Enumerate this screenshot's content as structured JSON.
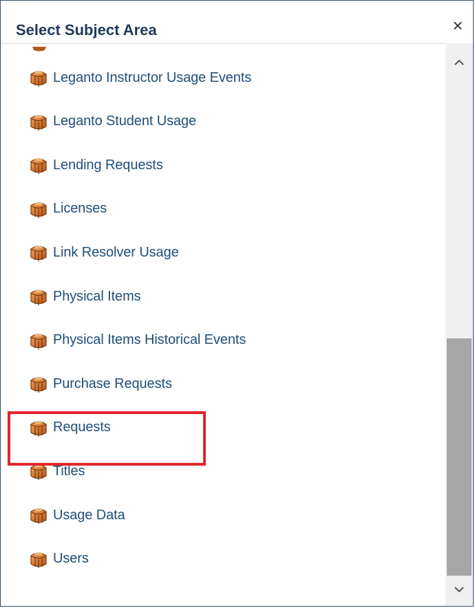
{
  "dialog": {
    "title": "Select Subject Area",
    "close_glyph": "×"
  },
  "items": [
    {
      "label": "Leganto Instructor Usage Events",
      "icon": "subject-area-cube-icon"
    },
    {
      "label": "Leganto Student Usage",
      "icon": "subject-area-cube-icon"
    },
    {
      "label": "Lending Requests",
      "icon": "subject-area-cube-icon"
    },
    {
      "label": "Licenses",
      "icon": "subject-area-cube-icon"
    },
    {
      "label": "Link Resolver Usage",
      "icon": "subject-area-cube-icon"
    },
    {
      "label": "Physical Items",
      "icon": "subject-area-cube-icon"
    },
    {
      "label": "Physical Items Historical Events",
      "icon": "subject-area-cube-icon"
    },
    {
      "label": "Purchase Requests",
      "icon": "subject-area-cube-icon",
      "highlighted": true
    },
    {
      "label": "Requests",
      "icon": "subject-area-cube-icon"
    },
    {
      "label": "Titles",
      "icon": "subject-area-cube-icon"
    },
    {
      "label": "Usage Data",
      "icon": "subject-area-cube-icon"
    },
    {
      "label": "Users",
      "icon": "subject-area-cube-icon"
    }
  ],
  "scrollbar": {
    "up_glyph": "^",
    "down_glyph": "⌄"
  },
  "colors": {
    "item_text": "#1f4e79",
    "title_text": "#1f3a5a",
    "highlight_border": "#e3242b",
    "icon_orange": "#c86a1e"
  }
}
